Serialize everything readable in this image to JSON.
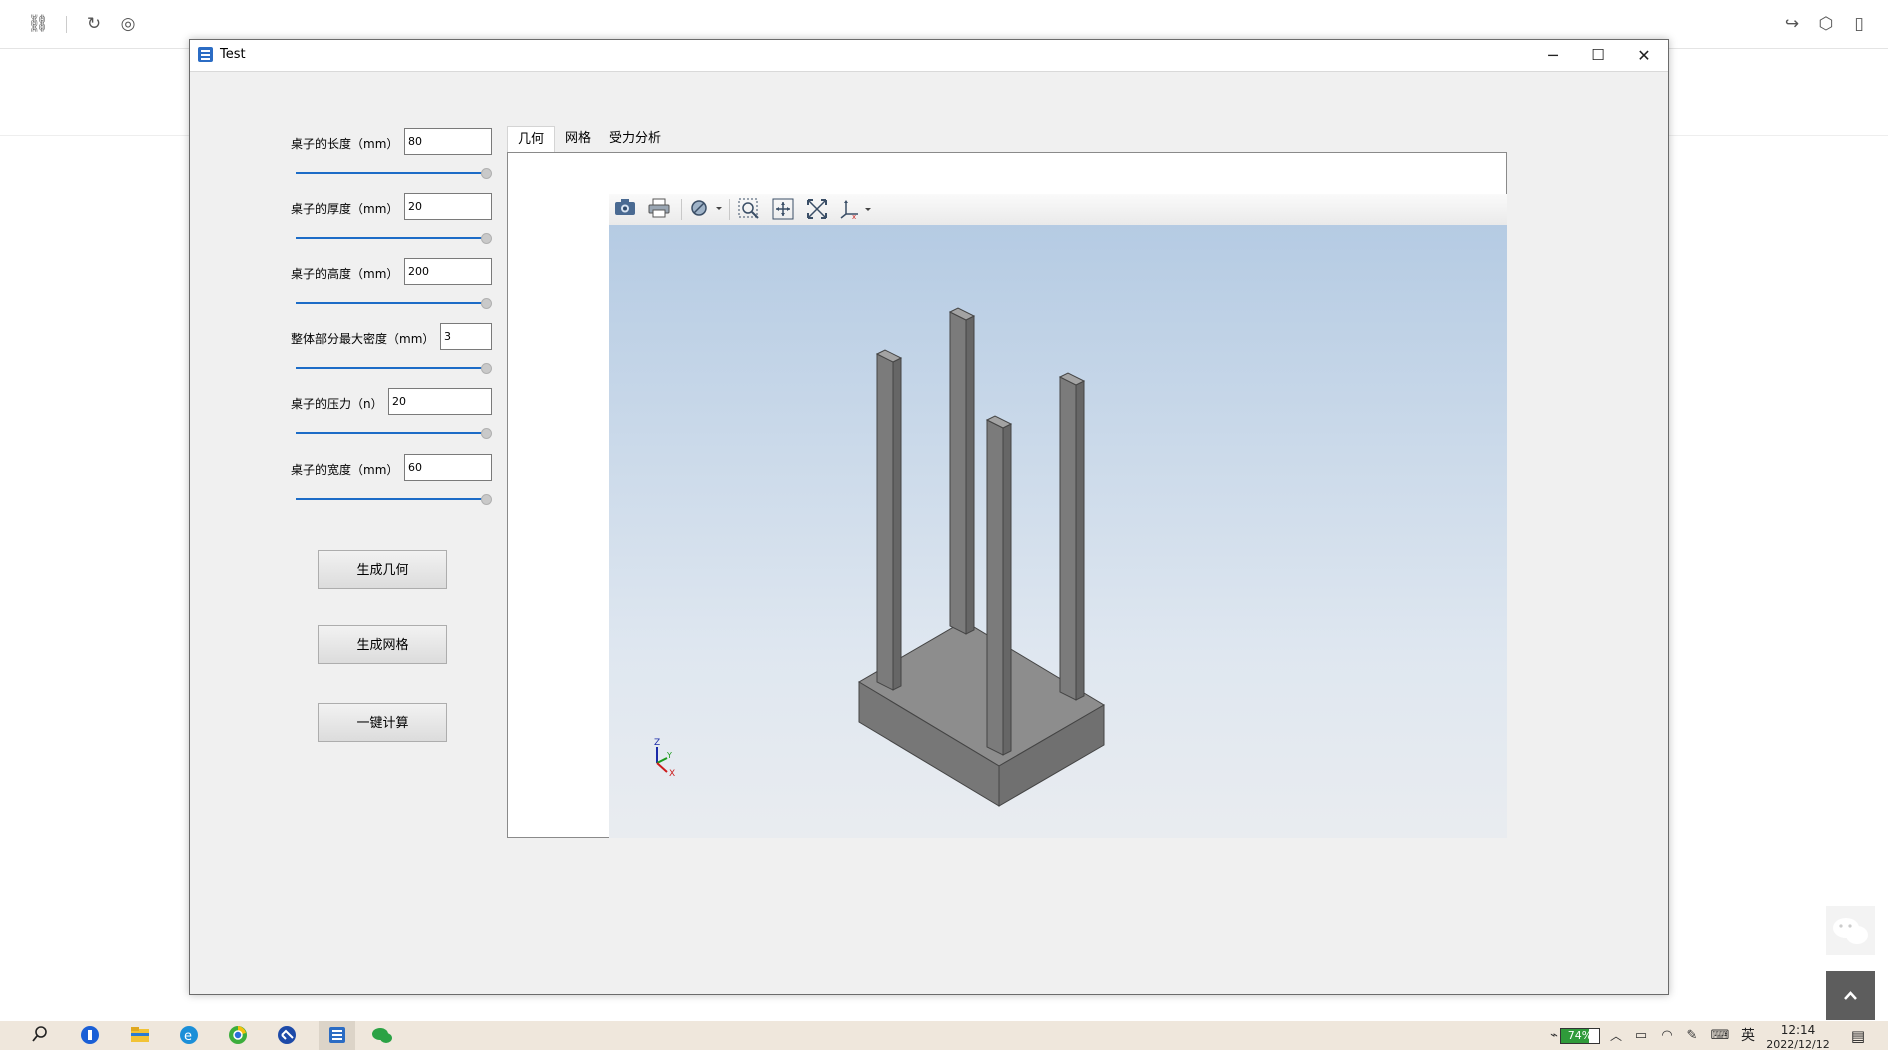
{
  "window": {
    "title": "Test",
    "minimize": "─",
    "maximize": "☐",
    "close": "✕"
  },
  "params": [
    {
      "label": "桌子的长度（mm）",
      "value": "80"
    },
    {
      "label": "桌子的厚度（mm）",
      "value": "20"
    },
    {
      "label": "桌子的高度（mm）",
      "value": "200"
    },
    {
      "label": "整体部分最大密度（mm）",
      "value": "3"
    },
    {
      "label": "桌子的压力（n）",
      "value": "20"
    },
    {
      "label": "桌子的宽度（mm）",
      "value": "60"
    }
  ],
  "buttons": {
    "generate_geometry": "生成几何",
    "generate_mesh": "生成网格",
    "compute": "一键计算"
  },
  "tabs": [
    "几何",
    "网格",
    "受力分析"
  ],
  "axes": {
    "z": "Z",
    "y": "Y",
    "x": "X"
  },
  "taskbar": {
    "battery": "74%",
    "ime": "英",
    "time": "12:14",
    "date": "2022/12/12"
  },
  "colors": {
    "accent": "#1c6cc7",
    "model": "#808080",
    "viewer_top": "#b5cbe3",
    "viewer_bottom": "#e9ecf0"
  }
}
